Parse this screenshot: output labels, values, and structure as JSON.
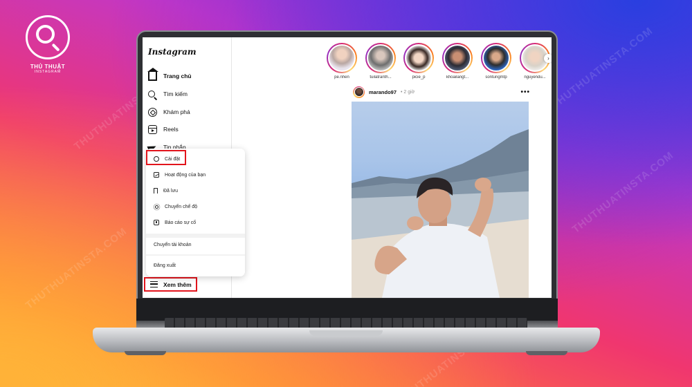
{
  "watermark": "THUTHUATINSTA.COM",
  "brand": {
    "name": "THỦ THUẬT",
    "sub": "INSTAGRAM"
  },
  "app": {
    "logo": "Instagram"
  },
  "sidebar": {
    "items": [
      {
        "label": "Trang chủ",
        "icon": "home-icon",
        "active": true
      },
      {
        "label": "Tìm kiếm",
        "icon": "search-icon"
      },
      {
        "label": "Khám phá",
        "icon": "compass-icon"
      },
      {
        "label": "Reels",
        "icon": "reels-icon"
      },
      {
        "label": "Tin nhắn",
        "icon": "send-icon"
      }
    ],
    "more_label": "Xem thêm"
  },
  "menu": {
    "items": [
      {
        "label": "Cài đặt",
        "icon": "gear-icon",
        "highlighted": true
      },
      {
        "label": "Hoạt động của bạn",
        "icon": "activity-icon"
      },
      {
        "label": "Đã lưu",
        "icon": "bookmark-icon"
      },
      {
        "label": "Chuyển chế độ",
        "icon": "sun-icon"
      },
      {
        "label": "Báo cáo sự cố",
        "icon": "report-icon"
      }
    ],
    "switch_account": "Chuyển tài khoản",
    "logout": "Đăng xuất"
  },
  "stories": [
    {
      "name": "pe.nhen"
    },
    {
      "name": "tuilatranth..."
    },
    {
      "name": "picie_p"
    },
    {
      "name": "khoailangt..."
    },
    {
      "name": "sontungmtp"
    },
    {
      "name": "nguyendu..."
    }
  ],
  "post": {
    "username": "marando97",
    "time": "• 2 giờ",
    "more": "•••"
  },
  "colors": {
    "highlight": "#e2141c",
    "story_ring": "#d62976"
  }
}
